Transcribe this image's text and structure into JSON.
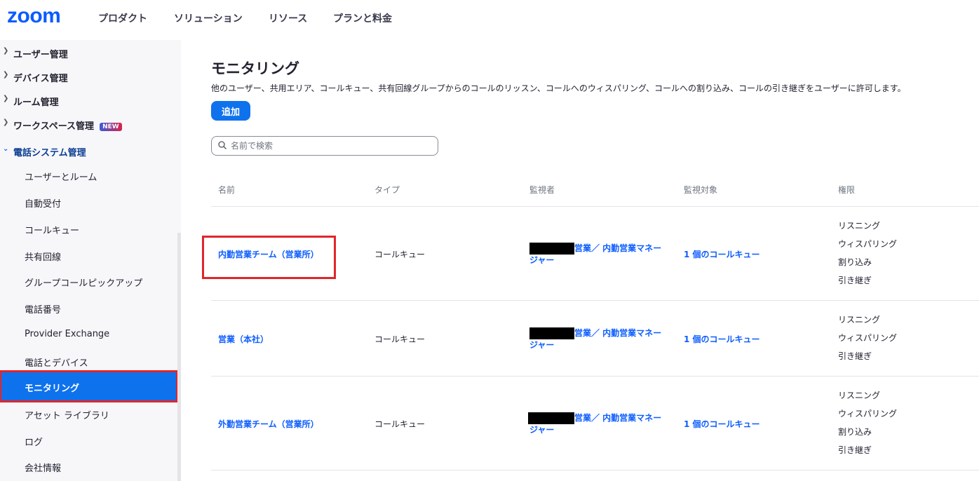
{
  "brand": {
    "logo_text": "zoom",
    "color": "#0b5cff"
  },
  "topnav": [
    "プロダクト",
    "ソリューション",
    "リソース",
    "プランと料金"
  ],
  "sidebar": {
    "sections": [
      {
        "label": "ユーザー管理",
        "expanded": false
      },
      {
        "label": "デバイス管理",
        "expanded": false
      },
      {
        "label": "ルーム管理",
        "expanded": false
      },
      {
        "label": "ワークスペース管理",
        "expanded": false,
        "badge": "NEW"
      },
      {
        "label": "電話システム管理",
        "expanded": true
      }
    ],
    "subitems": [
      "ユーザーとルーム",
      "自動受付",
      "コールキュー",
      "共有回線",
      "グループコールピックアップ",
      "電話番号",
      "Provider Exchange",
      "電話とデバイス",
      "モニタリング",
      "アセット ライブラリ",
      "ログ",
      "会社情報"
    ],
    "active": "モニタリング"
  },
  "page": {
    "title": "モニタリング",
    "description": "他のユーザー、共用エリア、コールキュー、共有回線グループからのコールのリッスン、コールへのウィスパリング、コールへの割り込み、コールの引き継ぎをユーザーに許可します。",
    "add_label": "追加",
    "search_placeholder": "名前で検索"
  },
  "table": {
    "headers": [
      "名前",
      "タイプ",
      "監視者",
      "監視対象",
      "権限"
    ],
    "rows": [
      {
        "name": "内勤営業チーム（営業所）",
        "type": "コールキュー",
        "supervisor_line1": "営業／ 内勤営業マネー",
        "supervisor_line2": "ジャー",
        "target": "1 個のコールキュー",
        "permissions": [
          "リスニング",
          "ウィスパリング",
          "割り込み",
          "引き継ぎ"
        ]
      },
      {
        "name": "営業（本社）",
        "type": "コールキュー",
        "supervisor_line1": "営業／ 内勤営業マネー",
        "supervisor_line2": "ジャー",
        "target": "1 個のコールキュー",
        "permissions": [
          "リスニング",
          "ウィスパリング",
          "引き継ぎ"
        ]
      },
      {
        "name": "外勤営業チーム（営業所）",
        "type": "コールキュー",
        "supervisor_line1": "営業／ 内勤営業マネー",
        "supervisor_line2": "ジャー",
        "target": "1 個のコールキュー",
        "permissions": [
          "リスニング",
          "ウィスパリング",
          "割り込み",
          "引き継ぎ"
        ]
      }
    ]
  }
}
